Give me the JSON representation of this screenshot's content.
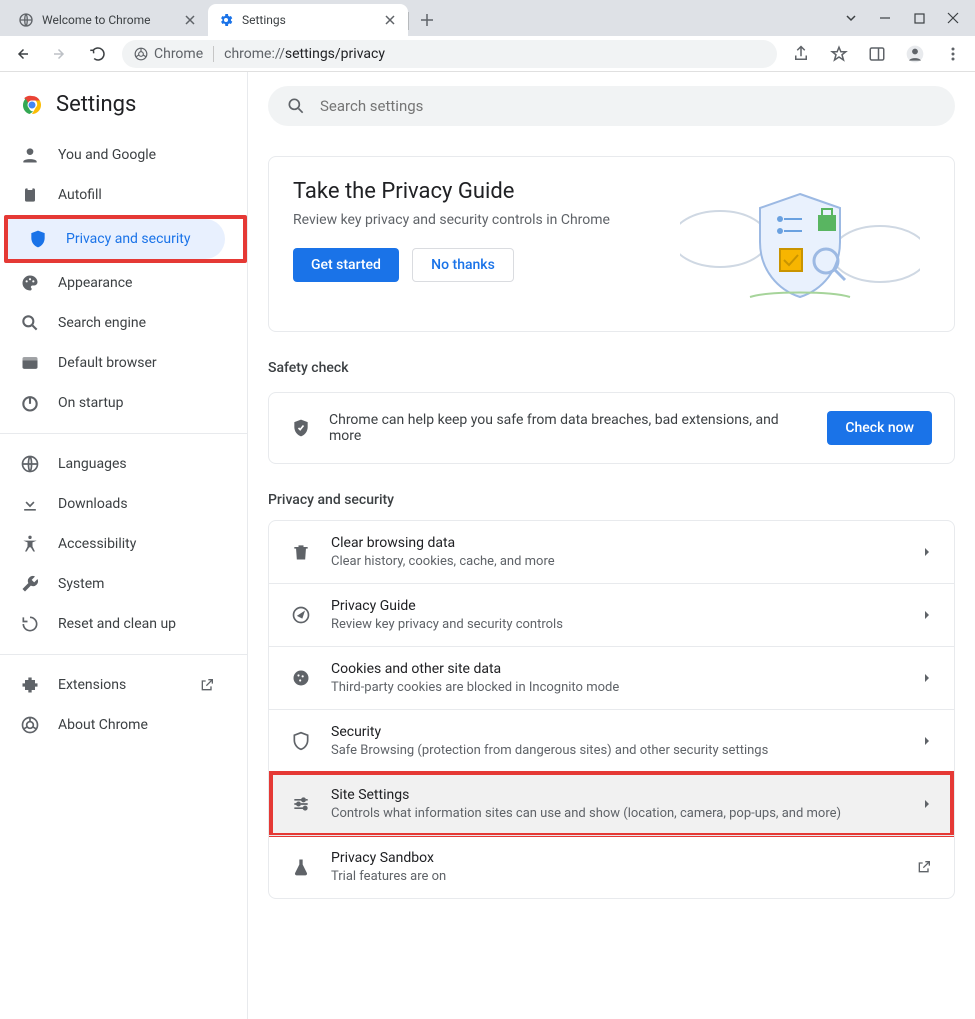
{
  "window": {
    "tabs": [
      {
        "title": "Welcome to Chrome"
      },
      {
        "title": "Settings"
      }
    ]
  },
  "toolbar": {
    "chrome_label": "Chrome",
    "url_gray": "chrome://",
    "url_dark": "settings/privacy"
  },
  "sidebar": {
    "title": "Settings",
    "items": [
      {
        "label": "You and Google"
      },
      {
        "label": "Autofill"
      },
      {
        "label": "Privacy and security"
      },
      {
        "label": "Appearance"
      },
      {
        "label": "Search engine"
      },
      {
        "label": "Default browser"
      },
      {
        "label": "On startup"
      }
    ],
    "items2": [
      {
        "label": "Languages"
      },
      {
        "label": "Downloads"
      },
      {
        "label": "Accessibility"
      },
      {
        "label": "System"
      },
      {
        "label": "Reset and clean up"
      }
    ],
    "items3": [
      {
        "label": "Extensions"
      },
      {
        "label": "About Chrome"
      }
    ]
  },
  "search": {
    "placeholder": "Search settings"
  },
  "privacy_guide": {
    "title": "Take the Privacy Guide",
    "subtitle": "Review key privacy and security controls in Chrome",
    "get_started": "Get started",
    "no_thanks": "No thanks"
  },
  "safety": {
    "heading": "Safety check",
    "text": "Chrome can help keep you safe from data breaches, bad extensions, and more",
    "check_now": "Check now"
  },
  "priv_section": {
    "heading": "Privacy and security",
    "rows": [
      {
        "title": "Clear browsing data",
        "sub": "Clear history, cookies, cache, and more"
      },
      {
        "title": "Privacy Guide",
        "sub": "Review key privacy and security controls"
      },
      {
        "title": "Cookies and other site data",
        "sub": "Third-party cookies are blocked in Incognito mode"
      },
      {
        "title": "Security",
        "sub": "Safe Browsing (protection from dangerous sites) and other security settings"
      },
      {
        "title": "Site Settings",
        "sub": "Controls what information sites can use and show (location, camera, pop-ups, and more)"
      },
      {
        "title": "Privacy Sandbox",
        "sub": "Trial features are on"
      }
    ]
  }
}
